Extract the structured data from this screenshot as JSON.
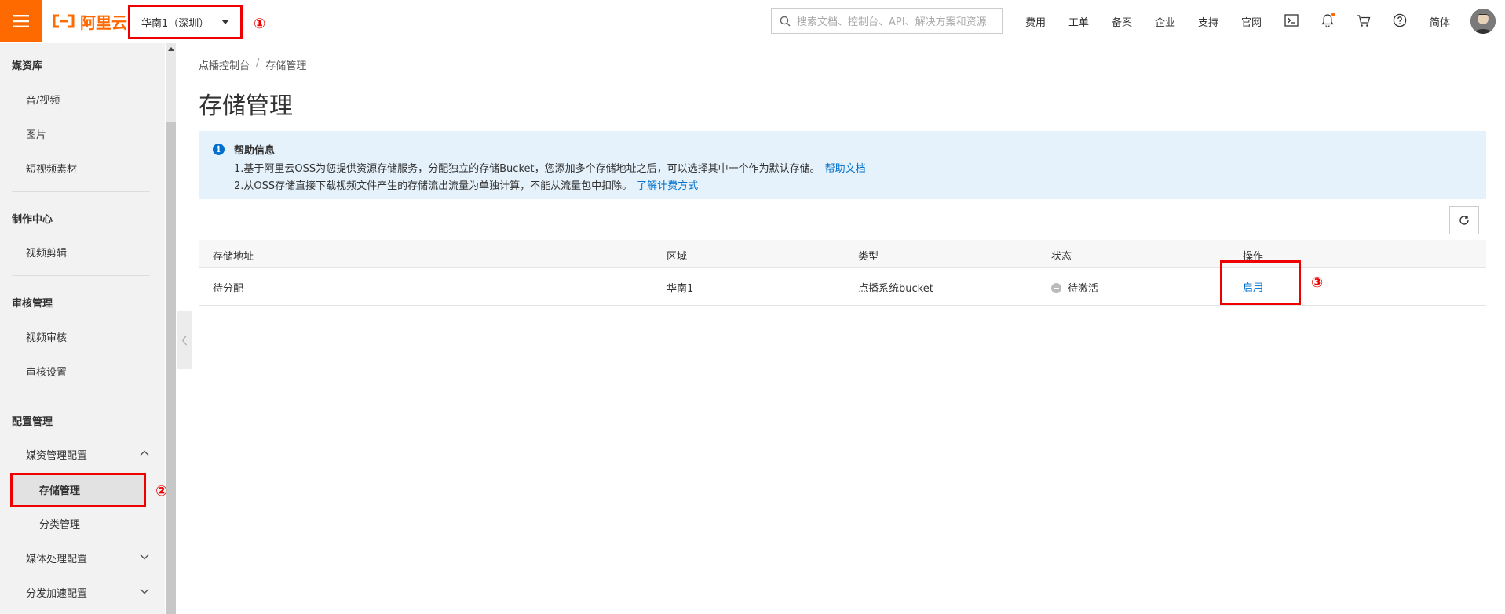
{
  "topbar": {
    "logo_text": "阿里云",
    "region": "华南1（深圳）",
    "search_placeholder": "搜索文档、控制台、API、解决方案和资源",
    "nav": [
      "费用",
      "工单",
      "备案",
      "企业",
      "支持",
      "官网"
    ],
    "language": "简体",
    "icons": [
      "terminal-icon",
      "bell-icon",
      "cart-icon",
      "help-icon"
    ]
  },
  "annotations": {
    "a1": "①",
    "a2": "②",
    "a3": "③"
  },
  "sidebar": {
    "groups": [
      {
        "title": "媒资库",
        "items": [
          "音/视频",
          "图片",
          "短视频素材"
        ]
      },
      {
        "title": "制作中心",
        "items": [
          "视频剪辑"
        ]
      },
      {
        "title": "审核管理",
        "items": [
          "视频审核",
          "审核设置"
        ]
      },
      {
        "title": "配置管理",
        "items": [
          "媒资管理配置",
          "媒体处理配置",
          "分发加速配置"
        ]
      }
    ],
    "sub_items": [
      "存储管理",
      "分类管理"
    ]
  },
  "breadcrumb": {
    "root": "点播控制台",
    "current": "存储管理"
  },
  "page_title": "存储管理",
  "help": {
    "title": "帮助信息",
    "line1": "1.基于阿里云OSS为您提供资源存储服务，分配独立的存储Bucket，您添加多个存储地址之后，可以选择其中一个作为默认存储。",
    "line1_link": "帮助文档",
    "line2": "2.从OSS存储直接下载视频文件产生的存储流出流量为单独计算，不能从流量包中扣除。",
    "line2_link": "了解计费方式"
  },
  "table": {
    "headers": [
      "存储地址",
      "区域",
      "类型",
      "状态",
      "操作"
    ],
    "rows": [
      {
        "address": "待分配",
        "region": "华南1",
        "type": "点播系统bucket",
        "status": "待激活",
        "action": "启用"
      }
    ]
  },
  "colors": {
    "brand": "#ff6a00",
    "link": "#0070cc",
    "highlight": "#e00000",
    "help_bg": "#e6f2fb"
  }
}
